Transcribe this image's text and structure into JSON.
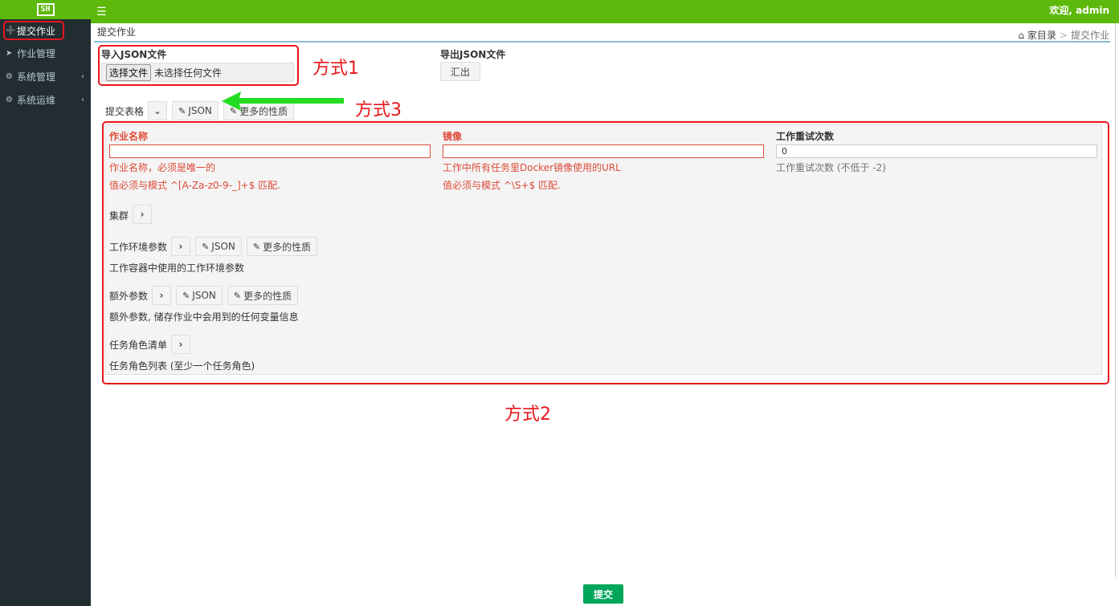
{
  "header": {
    "logo_text": "SH",
    "welcome": "欢迎, admin"
  },
  "sidebar": {
    "items": [
      {
        "label": "提交作业",
        "icon": "plus-circle-icon"
      },
      {
        "label": "作业管理",
        "icon": "rocket-icon"
      },
      {
        "label": "系统管理",
        "icon": "gears-icon"
      },
      {
        "label": "系统运维",
        "icon": "gears-icon"
      }
    ]
  },
  "page": {
    "title": "提交作业",
    "breadcrumb": {
      "home": "家目录",
      "current": "提交作业"
    }
  },
  "import": {
    "label": "导入JSON文件",
    "file_button": "选择文件",
    "file_status": "未选择任何文件"
  },
  "export": {
    "label": "导出JSON文件",
    "button": "汇出"
  },
  "form_toolbar": {
    "label": "提交表格",
    "json_button": "JSON",
    "more_button": "更多的性质"
  },
  "annotations": {
    "way1": "方式1",
    "way2": "方式2",
    "way3": "方式3"
  },
  "form": {
    "job_name": {
      "label": "作业名称",
      "value": "",
      "help": "作业名称，必须是唯一的",
      "error": "值必须与模式 ^[A-Za-z0-9-_]+$ 匹配."
    },
    "image": {
      "label": "镜像",
      "value": "",
      "help": "工作中所有任务里Docker镜像使用的URL",
      "error": "值必须与模式 ^\\S+$ 匹配."
    },
    "retry": {
      "label": "工作重试次数",
      "value": "0",
      "help": "工作重试次数 (不低于 -2)"
    },
    "cluster": {
      "label": "集群"
    },
    "env_params": {
      "label": "工作环境参数",
      "json_button": "JSON",
      "more_button": "更多的性质",
      "help": "工作容器中使用的工作环境参数"
    },
    "extras": {
      "label": "额外参数",
      "json_button": "JSON",
      "more_button": "更多的性质",
      "help": "额外参数, 储存作业中会用到的任何变量信息"
    },
    "task_roles": {
      "label": "任务角色清单",
      "help": "任务角色列表 (至少一个任务角色)"
    }
  },
  "submit_label": "提交",
  "colors": {
    "topbar": "#5cb90b",
    "sidebar": "#222d32",
    "error": "#dd4b39",
    "annotation": "#e8161c",
    "arrow": "#22dd22",
    "submit": "#00a65a"
  }
}
